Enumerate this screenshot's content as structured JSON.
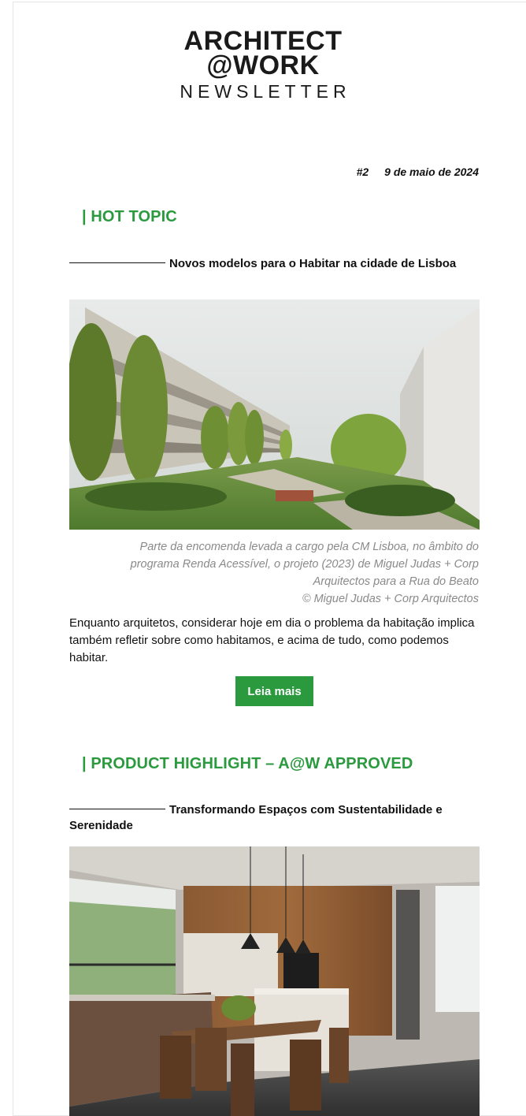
{
  "masthead": {
    "line1": "ARCHITECT",
    "line2": "@WORK",
    "line3": "NEWSLETTER"
  },
  "issue": {
    "number": "#2",
    "date": "9 de maio de 2024"
  },
  "sections": [
    {
      "title": "| HOT TOPIC",
      "heading": "Novos modelos para o Habitar na cidade de Lisboa",
      "image_alt": "apartment-courtyard-rendering",
      "caption_lines": [
        "Parte da encomenda levada a cargo pela CM Lisboa, no âmbito do",
        "programa Renda Acessível, o projeto (2023) de Miguel Judas + Corp",
        "Arquitectos para a Rua do Beato",
        "© Miguel Judas + Corp Arquitectos"
      ],
      "body": "Enquanto arquitetos, considerar hoje em dia o problema da habitação implica também refletir sobre como habitamos, e acima de tudo, como podemos habitar.",
      "button_label": "Leia mais"
    },
    {
      "title": "| PRODUCT HIGHLIGHT – A@W APPROVED",
      "heading": "Transformando Espaços com Sustentabilidade e Serenidade",
      "image_alt": "kitchen-interior-photo"
    }
  ],
  "colors": {
    "accent": "#2b9a3f",
    "caption": "#8a8a8a",
    "text": "#111111"
  }
}
